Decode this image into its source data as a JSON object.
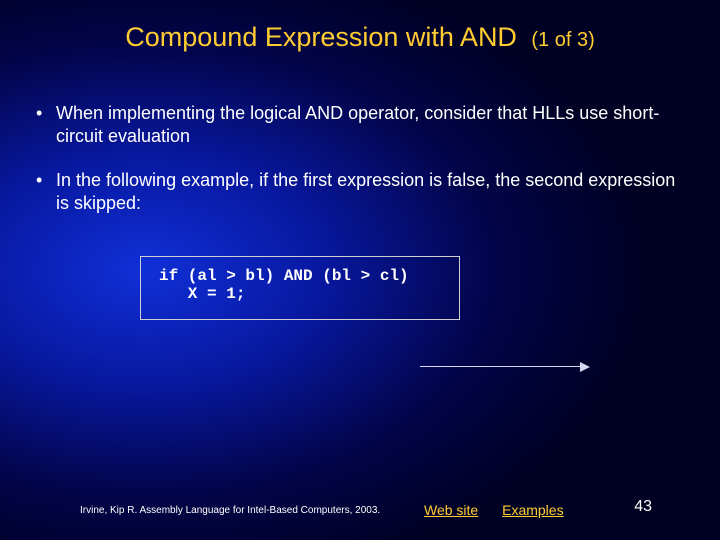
{
  "title": {
    "main": "Compound Expression with AND",
    "sub": "(1 of 3)"
  },
  "bullets": [
    "When implementing the logical AND operator, consider that HLLs use short-circuit evaluation",
    "In the following example, if the first expression is false, the second expression is skipped:"
  ],
  "code": "if (al > bl) AND (bl > cl)\n   X = 1;",
  "footer": {
    "citation": "Irvine, Kip R. Assembly Language for Intel-Based Computers, 2003.",
    "links": [
      "Web site",
      "Examples"
    ],
    "page": "43"
  }
}
